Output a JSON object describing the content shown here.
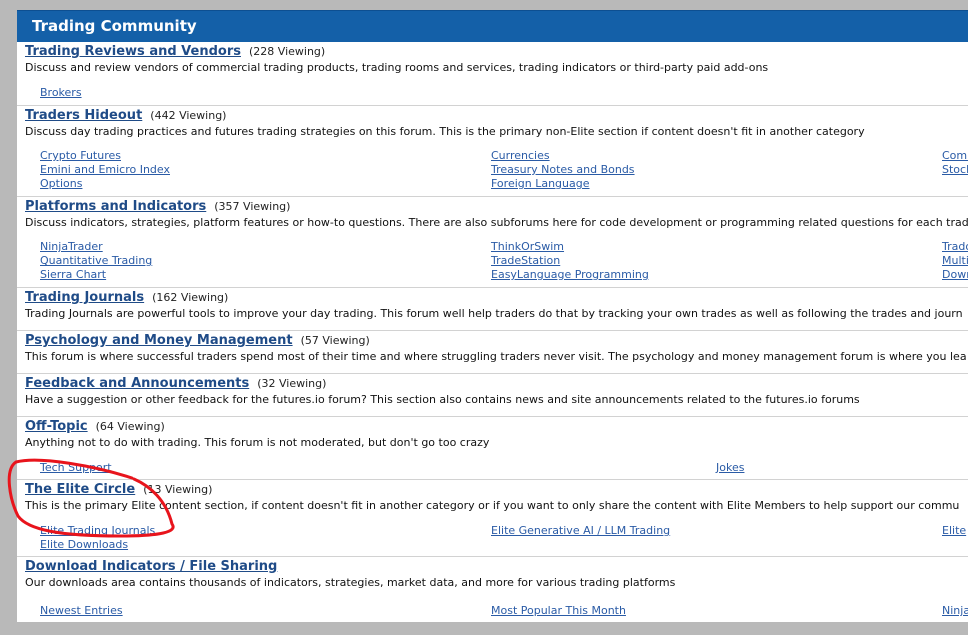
{
  "header": {
    "title": "Trading Community"
  },
  "forums": [
    {
      "title": "Trading Reviews and Vendors",
      "viewing": "(228 Viewing)",
      "description": "Discuss and review vendors of commercial trading products, trading rooms and services, trading indicators or third-party paid add-ons",
      "subforums": [
        "Brokers"
      ]
    },
    {
      "title": "Traders Hideout",
      "viewing": "(442 Viewing)",
      "description": "Discuss day trading practices and futures trading strategies on this forum. This is the primary non-Elite section if content doesn't fit in another category",
      "subforums": [
        "Crypto Futures",
        "Currencies",
        "Comm",
        "Emini and Emicro Index",
        "Treasury Notes and Bonds",
        "Stock",
        "Options",
        "Foreign Language"
      ]
    },
    {
      "title": "Platforms and Indicators",
      "viewing": "(357 Viewing)",
      "description": "Discuss indicators, strategies, platform features or how-to questions. There are also subforums here for code development or programming related questions for each trad",
      "subforums": [
        "NinjaTrader",
        "ThinkOrSwim",
        "Trado",
        "Quantitative Trading",
        "TradeStation",
        "Multi",
        "Sierra Chart",
        "EasyLanguage Programming",
        "Down"
      ]
    },
    {
      "title": "Trading Journals",
      "viewing": "(162 Viewing)",
      "description": "Trading Journals are powerful tools to improve your day trading. This forum well help traders do that by tracking your own trades as well as following the trades and journ",
      "subforums": []
    },
    {
      "title": "Psychology and Money Management",
      "viewing": "(57 Viewing)",
      "description": "This forum is where successful traders spend most of their time and where struggling traders never visit. The psychology and money management forum is where you lea",
      "subforums": []
    },
    {
      "title": "Feedback and Announcements",
      "viewing": "(32 Viewing)",
      "description": "Have a suggestion or other feedback for the futures.io forum? This section also contains news and site announcements related to the futures.io forums",
      "subforums": []
    },
    {
      "title": "Off-Topic",
      "viewing": "(64 Viewing)",
      "description": "Anything not to do with trading. This forum is not moderated, but don't go too crazy",
      "subforums": [
        "Tech Support",
        "Jokes"
      ]
    },
    {
      "title": "The Elite Circle",
      "viewing": "(13 Viewing)",
      "description": "This is the primary Elite content section, if content doesn't fit in another category or if you want to only share the content with Elite Members to help support our commu",
      "subforums": [
        "Elite Trading Journals",
        "Elite Generative AI / LLM Trading",
        "Elite",
        "Elite Downloads"
      ]
    },
    {
      "title": "Download Indicators / File Sharing",
      "viewing": "",
      "description": "Our downloads area contains thousands of indicators, strategies, market data, and more for various trading platforms",
      "subforums": [
        "Newest Entries",
        "Most Popular This Month",
        "Ninja"
      ]
    }
  ],
  "colors": {
    "header_bg": "#1460a8",
    "link": "#2a5ba6",
    "title": "#1f4b87",
    "annotation": "#e8141c"
  }
}
